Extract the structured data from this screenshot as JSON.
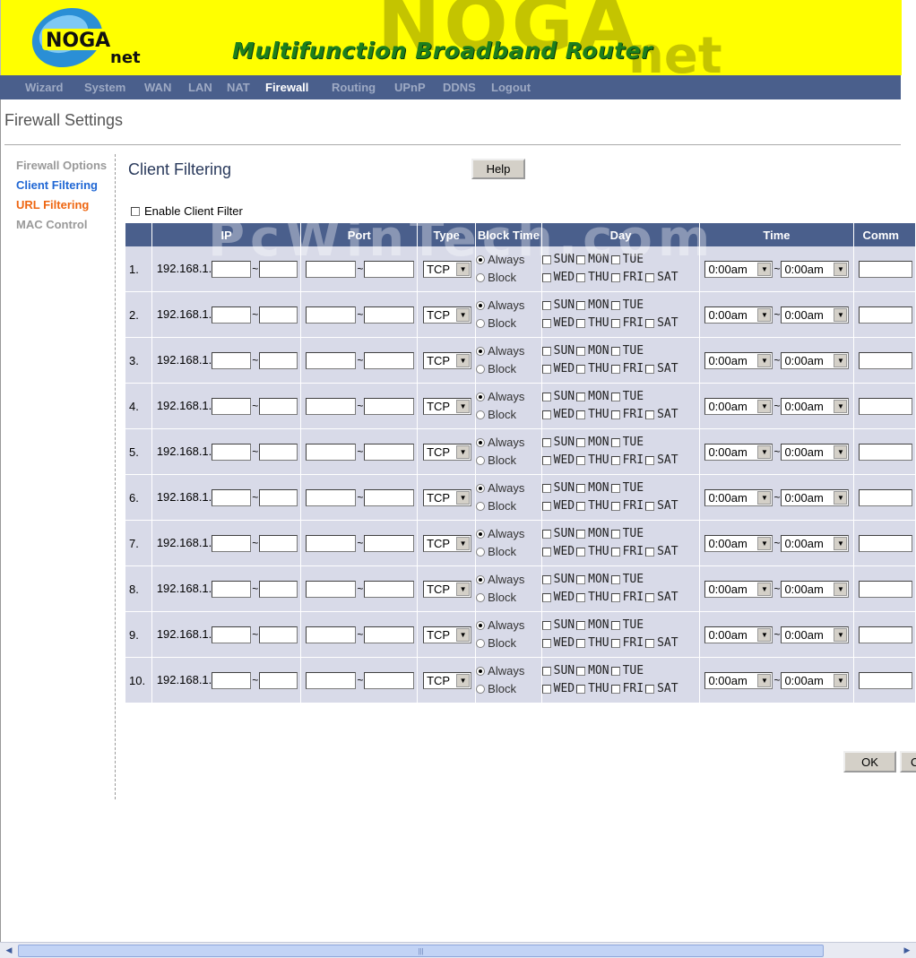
{
  "banner": {
    "title": "Multifunction Broadband Router",
    "logo_text_top": "NOGA",
    "logo_text_bottom": "net"
  },
  "nav": {
    "items": [
      "Wizard",
      "System",
      "WAN",
      "LAN",
      "NAT",
      "Firewall",
      "Routing",
      "UPnP",
      "DDNS",
      "Logout"
    ],
    "active": "Firewall"
  },
  "page_title": "Firewall Settings",
  "sidebar": {
    "items": [
      {
        "label": "Firewall Options",
        "color": "#999999"
      },
      {
        "label": "Client Filtering",
        "color": "#2067d4"
      },
      {
        "label": "URL Filtering",
        "color": "#ee6611"
      },
      {
        "label": "MAC Control",
        "color": "#999999"
      }
    ]
  },
  "section_title": "Client Filtering",
  "help_label": "Help",
  "enable_label": "Enable Client Filter",
  "watermark": "PcWinTech.com",
  "table": {
    "headers": [
      "IP",
      "Port",
      "Type",
      "Block Time",
      "Day",
      "Time",
      "Comm"
    ],
    "ip_prefix": "192.168.1.",
    "tilde": "~",
    "type_value": "TCP",
    "block_always": "Always",
    "block_block": "Block",
    "days_row1": [
      "SUN",
      "MON",
      "TUE"
    ],
    "days_row2": [
      "WED",
      "THU",
      "FRI",
      "SAT"
    ],
    "time_from": "0:00am",
    "time_to": "0:00am",
    "rows": [
      "1.",
      "2.",
      "3.",
      "4.",
      "5.",
      "6.",
      "7.",
      "8.",
      "9.",
      "10."
    ]
  },
  "ok_label": "OK",
  "cancel_label": "Cancel",
  "colors": {
    "banner_bg": "#ffff00",
    "nav_bg": "#4a5f8c",
    "table_header": "#4a5f8c",
    "table_row": "#d8dae8",
    "banner_title": "#1d7f1d"
  }
}
